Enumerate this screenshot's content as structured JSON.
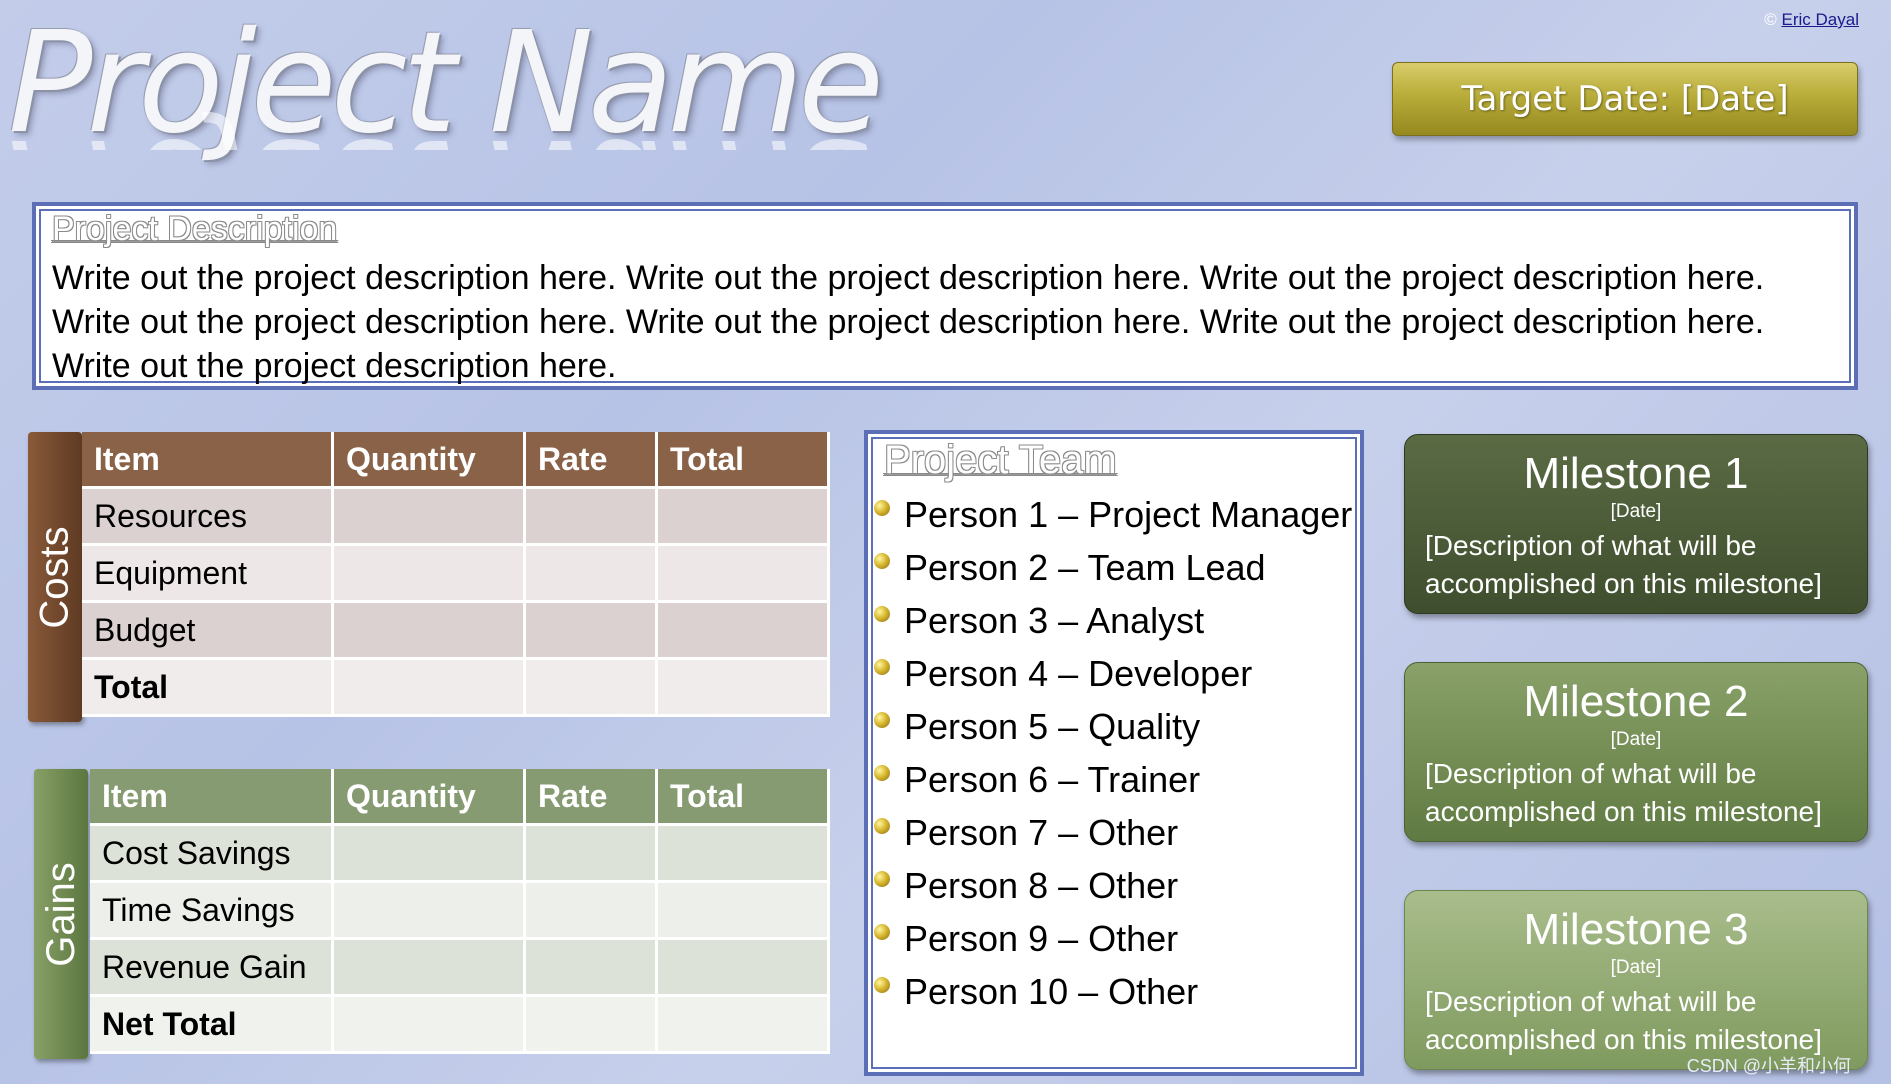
{
  "header": {
    "title": "Project Name",
    "credit_symbol": "©",
    "credit_name": "Eric Dayal",
    "target_date": "Target Date: [Date]"
  },
  "description": {
    "heading": "Project Description",
    "text": "Write out the project description here. Write out the project description here. Write out the project description here. Write out the project description here. Write out the project description here. Write out the project description here. Write out the project description here."
  },
  "costs": {
    "tab_label": "Costs",
    "headers": [
      "Item",
      "Quantity",
      "Rate",
      "Total"
    ],
    "rows": [
      {
        "item": "Resources",
        "quantity": "",
        "rate": "",
        "total": ""
      },
      {
        "item": "Equipment",
        "quantity": "",
        "rate": "",
        "total": ""
      },
      {
        "item": "Budget",
        "quantity": "",
        "rate": "",
        "total": ""
      },
      {
        "item": "Total",
        "quantity": "",
        "rate": "",
        "total": ""
      }
    ]
  },
  "gains": {
    "tab_label": "Gains",
    "headers": [
      "Item",
      "Quantity",
      "Rate",
      "Total"
    ],
    "rows": [
      {
        "item": "Cost Savings",
        "quantity": "",
        "rate": "",
        "total": ""
      },
      {
        "item": "Time Savings",
        "quantity": "",
        "rate": "",
        "total": ""
      },
      {
        "item": "Revenue Gain",
        "quantity": "",
        "rate": "",
        "total": ""
      },
      {
        "item": "Net Total",
        "quantity": "",
        "rate": "",
        "total": ""
      }
    ]
  },
  "team": {
    "heading": "Project Team",
    "members": [
      "Person 1 – Project Manager",
      "Person 2 – Team Lead",
      "Person 3 – Analyst",
      "Person 4 – Developer",
      "Person 5 – Quality",
      "Person 6 – Trainer",
      "Person 7 – Other",
      "Person 8 – Other",
      "Person 9 – Other",
      "Person 10 – Other"
    ]
  },
  "milestones": [
    {
      "title": "Milestone 1",
      "date": "[Date]",
      "description": "[Description of what will be accomplished on this milestone]"
    },
    {
      "title": "Milestone 2",
      "date": "[Date]",
      "description": "[Description of what will be accomplished on this milestone]"
    },
    {
      "title": "Milestone 3",
      "date": "[Date]",
      "description": "[Description of what will be accomplished on this milestone]"
    }
  ],
  "watermark": "CSDN @小羊和小何",
  "colors": {
    "background": "#bfc9e8",
    "costs_header": "#8a6248",
    "gains_header": "#879b72",
    "target_button": "#b8ac3a",
    "milestone_1": "#4a5a36",
    "milestone_2": "#71894f",
    "milestone_3": "#93ab74",
    "box_border": "#5b6eb6"
  }
}
